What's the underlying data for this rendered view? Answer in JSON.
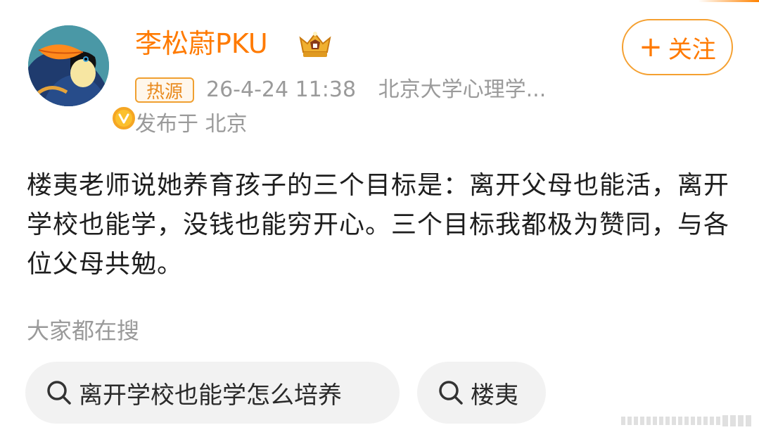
{
  "post": {
    "username": "李松蔚PKU",
    "follow_label": "关注",
    "hot_badge": "热源",
    "timestamp": "26-4-24 11:38",
    "source": "北京大学心理学...",
    "location": "发布于 北京",
    "content": "楼夷老师说她养育孩子的三个目标是：离开父母也能活，离开学校也能学，没钱也能穷开心。三个目标我都极为赞同，与各位父母共勉。"
  },
  "search": {
    "title": "大家都在搜",
    "chips": [
      {
        "label": "离开学校也能学怎么培养"
      },
      {
        "label": "楼夷"
      }
    ]
  },
  "colors": {
    "accent": "#ff7a00",
    "badge_border": "#f0a030",
    "muted_text": "#9a9a9a",
    "chip_bg": "#f2f2f2"
  },
  "icons": {
    "verified": "verified-badge-icon",
    "crown": "crown-membership-icon",
    "search": "search-icon",
    "plus": "plus-icon"
  }
}
